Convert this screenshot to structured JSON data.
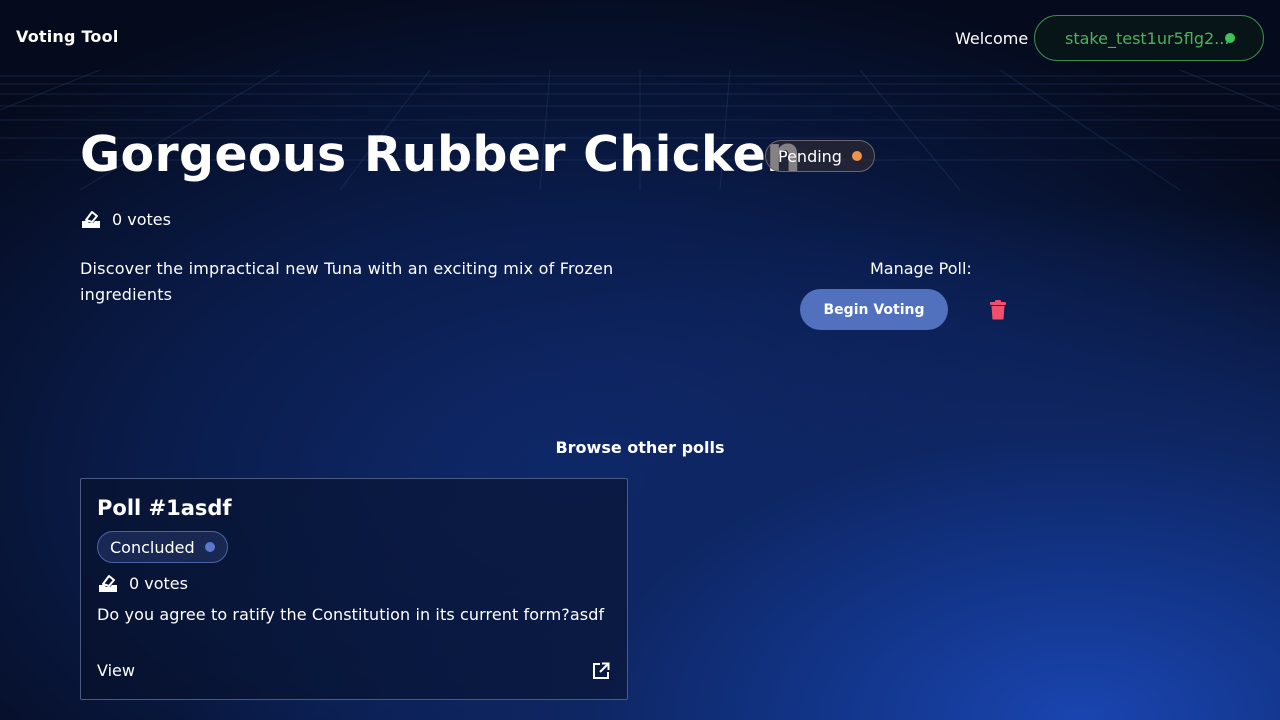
{
  "header": {
    "brand": "Voting Tool",
    "welcome": "Welcome",
    "wallet": "stake_test1ur5flg2...",
    "wallet_status_color": "#3fc25a"
  },
  "poll": {
    "title": "Gorgeous Rubber Chicken",
    "status": "Pending",
    "status_color": "#f2914a",
    "votes": "0 votes",
    "description": "Discover the impractical new Tuna with an exciting mix of Frozen ingredients"
  },
  "manage": {
    "label": "Manage Poll:",
    "begin_button": "Begin Voting",
    "delete_icon": "trash-icon"
  },
  "browse": {
    "heading": "Browse other polls",
    "polls": [
      {
        "title": "Poll #1asdf",
        "status": "Concluded",
        "status_color": "#5b78c8",
        "votes": "0 votes",
        "question": "Do you agree to ratify the Constitution in its current form?asdf",
        "view_label": "View",
        "link_icon": "external-link-icon"
      }
    ]
  }
}
